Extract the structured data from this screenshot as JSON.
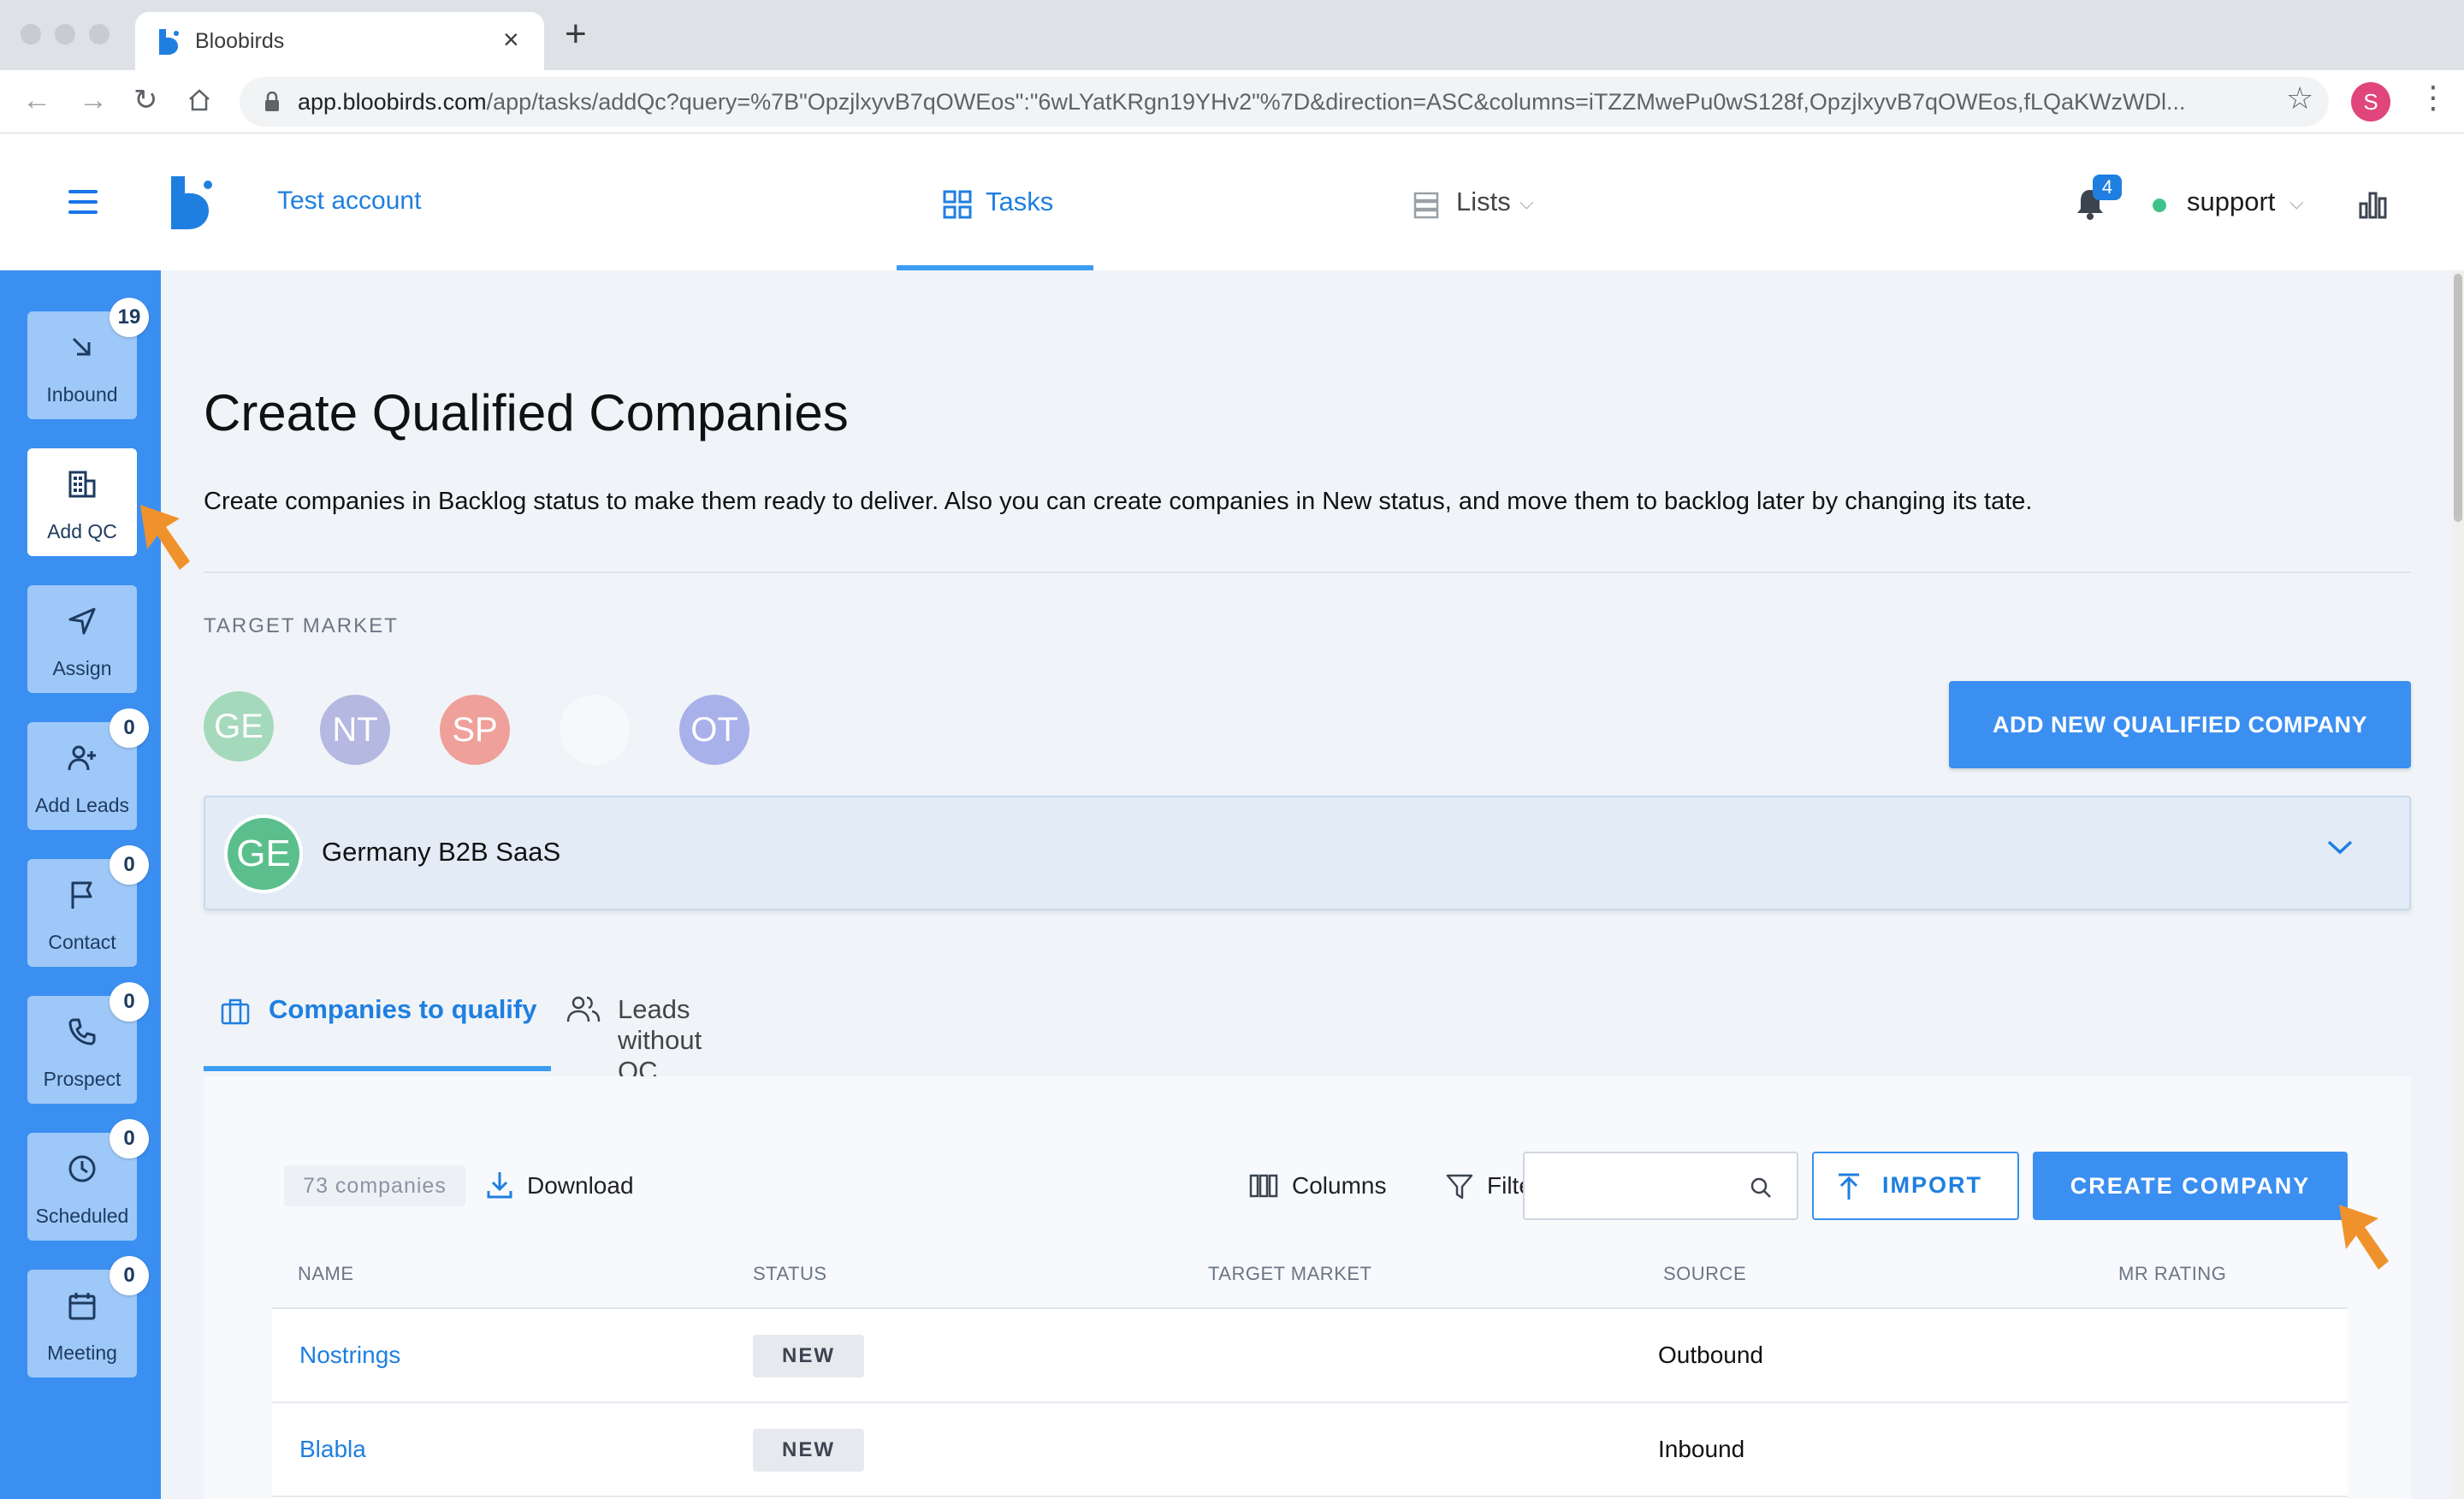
{
  "browser": {
    "tab_title": "Bloobirds",
    "url_host": "app.bloobirds.com",
    "url_path": "/app/tasks/addQc?query=%7B\"OpzjlxyvB7qOWEos\":\"6wLYatKRgn19YHv2\"%7D&direction=ASC&columns=iTZZMwePu0wS128f,OpzjlxyvB7qOWEos,fLQaKWzWDl...",
    "profile_initial": "S"
  },
  "header": {
    "account_name": "Test account",
    "nav_tasks": "Tasks",
    "nav_lists": "Lists",
    "notification_count": "4",
    "user_name": "support"
  },
  "sidebar": {
    "items": [
      {
        "label": "Inbound",
        "badge": "19",
        "icon": "arrow-down-right-icon"
      },
      {
        "label": "Add QC",
        "badge": "",
        "icon": "building-icon",
        "active": true
      },
      {
        "label": "Assign",
        "badge": "",
        "icon": "send-icon"
      },
      {
        "label": "Add Leads",
        "badge": "0",
        "icon": "add-user-icon"
      },
      {
        "label": "Contact",
        "badge": "0",
        "icon": "flag-icon"
      },
      {
        "label": "Prospect",
        "badge": "0",
        "icon": "phone-icon"
      },
      {
        "label": "Scheduled",
        "badge": "0",
        "icon": "clock-icon"
      },
      {
        "label": "Meeting",
        "badge": "0",
        "icon": "calendar-icon"
      }
    ]
  },
  "page": {
    "title": "Create Qualified Companies",
    "description": "Create companies in Backlog status to make them ready to deliver. Also you can create companies in New status, and move them to backlog later by changing its tate.",
    "target_market_label": "TARGET MARKET",
    "target_markets": [
      {
        "initials": "GE",
        "color": "#a5d9bc"
      },
      {
        "initials": "NT",
        "color": "#b5b8e0"
      },
      {
        "initials": "SP",
        "color": "#f0a09a"
      },
      {
        "initials": "",
        "color": "#f7f8fa"
      },
      {
        "initials": "OT",
        "color": "#a9b1eb"
      }
    ],
    "add_qc_button": "ADD NEW QUALIFIED COMPANY",
    "selected_market": {
      "initials": "GE",
      "name": "Germany B2B SaaS"
    }
  },
  "tabs": {
    "companies": "Companies to qualify",
    "leads": "Leads without QC"
  },
  "toolbar": {
    "count": "73 companies",
    "download": "Download",
    "columns": "Columns",
    "filters": "Filters",
    "search_value": "",
    "import": "IMPORT",
    "create": "CREATE COMPANY"
  },
  "table": {
    "headers": [
      "NAME",
      "STATUS",
      "TARGET MARKET",
      "SOURCE",
      "MR RATING"
    ],
    "rows": [
      {
        "name": "Nostrings",
        "status": "NEW",
        "target_market": "",
        "source": "Outbound",
        "mr_rating": ""
      },
      {
        "name": "Blabla",
        "status": "NEW",
        "target_market": "",
        "source": "Inbound",
        "mr_rating": ""
      }
    ]
  },
  "colors": {
    "brand_blue": "#3b8ff1",
    "link_blue": "#1f7fe0",
    "cursor_orange": "#f0922c"
  }
}
